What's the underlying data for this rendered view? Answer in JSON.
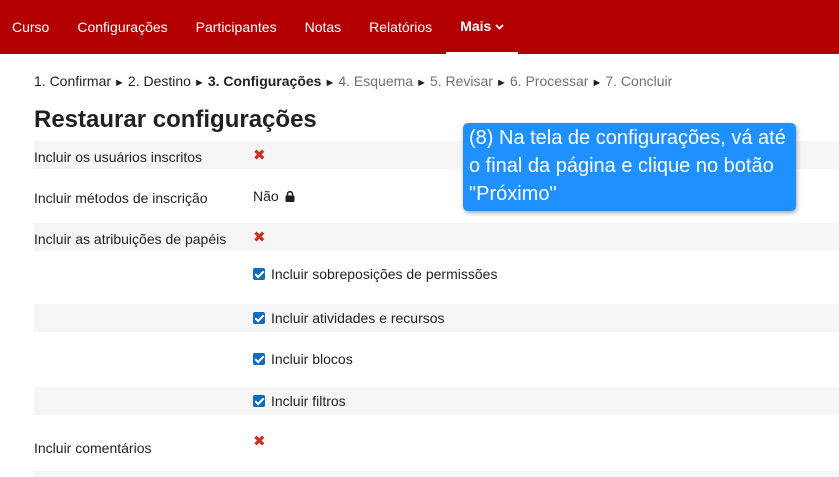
{
  "nav": {
    "items": [
      "Curso",
      "Configurações",
      "Participantes",
      "Notas",
      "Relatórios"
    ],
    "more_label": "Mais"
  },
  "steps": {
    "done": [
      "1. Confirmar",
      "2. Destino"
    ],
    "current": "3. Configurações",
    "future": [
      "4. Esquema",
      "5. Revisar",
      "6. Processar",
      "7. Concluir"
    ],
    "separator": "►"
  },
  "page_title": "Restaurar configurações",
  "settings": {
    "users_label": "Incluir os usuários inscritos",
    "enrol_methods_label": "Incluir métodos de inscrição",
    "enrol_methods_value": "Não",
    "role_assignments_label": "Incluir as atribuições de papéis",
    "permission_overrides_label": "Incluir sobreposições de permissões",
    "activities_label": "Incluir atividades e recursos",
    "blocks_label": "Incluir blocos",
    "filters_label": "Incluir filtros",
    "comments_label": "Incluir comentários",
    "disabled_glyph": "✖"
  },
  "callout": {
    "text": "(8) Na tela de configurações, vá até o final da página e clique no botão \"Próximo\""
  },
  "colors": {
    "nav_bg": "#b20000",
    "checkbox": "#0f6cbf",
    "x_mark": "#ca3120",
    "callout_bg": "#1e90ff"
  }
}
